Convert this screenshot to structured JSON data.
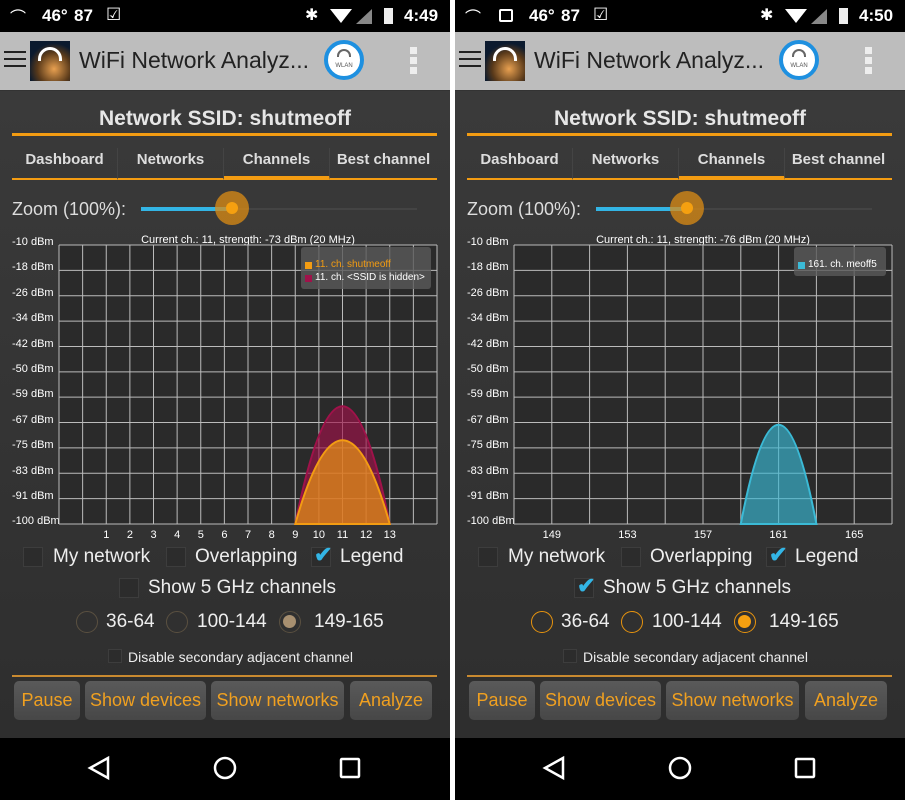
{
  "phones": [
    {
      "status": {
        "temp": "46°",
        "count": "87",
        "time": "4:49",
        "icons": [
          "phone-hangup-icon",
          "check-box-icon",
          "bluetooth-icon",
          "wifi-icon",
          "signal-icon",
          "battery-icon"
        ]
      },
      "app": {
        "title": "WiFi Network Analyz...",
        "wlan_badge": "WLAN"
      },
      "network_title": "Network SSID: shutmeoff",
      "tabs": [
        {
          "label": "Dashboard",
          "active": false
        },
        {
          "label": "Networks",
          "active": false
        },
        {
          "label": "Channels",
          "active": true
        },
        {
          "label": "Best channel",
          "active": false
        }
      ],
      "zoom": {
        "label": "Zoom (100%):",
        "value_fraction": 0.33
      },
      "options": {
        "my_network": {
          "label": "My network",
          "checked": false
        },
        "overlapping": {
          "label": "Overlapping",
          "checked": false
        },
        "legend": {
          "label": "Legend",
          "checked": true
        },
        "show_5ghz": {
          "label": "Show 5 GHz channels",
          "checked": false
        },
        "disable_secondary": {
          "label": "Disable secondary adjacent channel",
          "checked": false
        }
      },
      "bands": [
        {
          "label": "36-64",
          "selected": false
        },
        {
          "label": "100-144",
          "selected": false
        },
        {
          "label": "149-165",
          "selected": true
        }
      ],
      "band_enabled": false,
      "buttons": [
        "Pause",
        "Show devices",
        "Show networks",
        "Analyze"
      ]
    },
    {
      "status": {
        "temp": "46°",
        "count": "87",
        "time": "4:50",
        "icons": [
          "phone-hangup-icon",
          "image-icon",
          "check-box-icon",
          "bluetooth-icon",
          "wifi-icon",
          "signal-icon",
          "battery-icon"
        ]
      },
      "app": {
        "title": "WiFi Network Analyz...",
        "wlan_badge": "WLAN"
      },
      "network_title": "Network SSID: shutmeoff",
      "tabs": [
        {
          "label": "Dashboard",
          "active": false
        },
        {
          "label": "Networks",
          "active": false
        },
        {
          "label": "Channels",
          "active": true
        },
        {
          "label": "Best channel",
          "active": false
        }
      ],
      "zoom": {
        "label": "Zoom (100%):",
        "value_fraction": 0.33
      },
      "options": {
        "my_network": {
          "label": "My network",
          "checked": false
        },
        "overlapping": {
          "label": "Overlapping",
          "checked": false
        },
        "legend": {
          "label": "Legend",
          "checked": true
        },
        "show_5ghz": {
          "label": "Show 5 GHz channels",
          "checked": true
        },
        "disable_secondary": {
          "label": "Disable secondary adjacent channel",
          "checked": false
        }
      },
      "bands": [
        {
          "label": "36-64",
          "selected": false
        },
        {
          "label": "100-144",
          "selected": false
        },
        {
          "label": "149-165",
          "selected": true
        }
      ],
      "band_enabled": true,
      "buttons": [
        "Pause",
        "Show devices",
        "Show networks",
        "Analyze"
      ]
    }
  ],
  "chart_data": [
    {
      "type": "area",
      "title": "Current ch.: 11, strength: -73 dBm (20 MHz)",
      "xlim": [
        -1,
        15
      ],
      "ylim": [
        -100,
        -10
      ],
      "x_ticks": [
        1,
        2,
        3,
        4,
        5,
        6,
        7,
        8,
        9,
        10,
        11,
        12,
        13
      ],
      "y_ticks": [
        "-10 dBm",
        "-18 dBm",
        "-26 dBm",
        "-34 dBm",
        "-42 dBm",
        "-50 dBm",
        "-59 dBm",
        "-67 dBm",
        "-75 dBm",
        "-83 dBm",
        "-91 dBm",
        "-100 dBm"
      ],
      "grid": true,
      "legend_position": "top-right",
      "series": [
        {
          "name": "11. ch. <SSID is hidden>",
          "channel": 11,
          "width": 4,
          "peak_dbm": -62,
          "color": "#a0124a"
        },
        {
          "name": "11. ch. shutmeoff",
          "channel": 11,
          "width": 4,
          "peak_dbm": -73,
          "color": "#f39c12"
        }
      ]
    },
    {
      "type": "area",
      "title": "Current ch.: 11, strength: -76 dBm (20 MHz)",
      "xlim": [
        147,
        167
      ],
      "ylim": [
        -100,
        -10
      ],
      "x_ticks": [
        149,
        153,
        157,
        161,
        165
      ],
      "y_ticks": [
        "-10 dBm",
        "-18 dBm",
        "-26 dBm",
        "-34 dBm",
        "-42 dBm",
        "-50 dBm",
        "-59 dBm",
        "-67 dBm",
        "-75 dBm",
        "-83 dBm",
        "-91 dBm",
        "-100 dBm"
      ],
      "grid": true,
      "legend_position": "top-right",
      "series": [
        {
          "name": "161. ch. meoff5",
          "channel": 161,
          "width": 4,
          "peak_dbm": -68,
          "color": "#3bbad6"
        }
      ]
    }
  ],
  "nav": {
    "icons": [
      "back-icon",
      "home-icon",
      "recents-icon"
    ]
  },
  "colors": {
    "accent": "#f39c12",
    "check": "#33b5e5",
    "slider": "#33b5e5"
  }
}
